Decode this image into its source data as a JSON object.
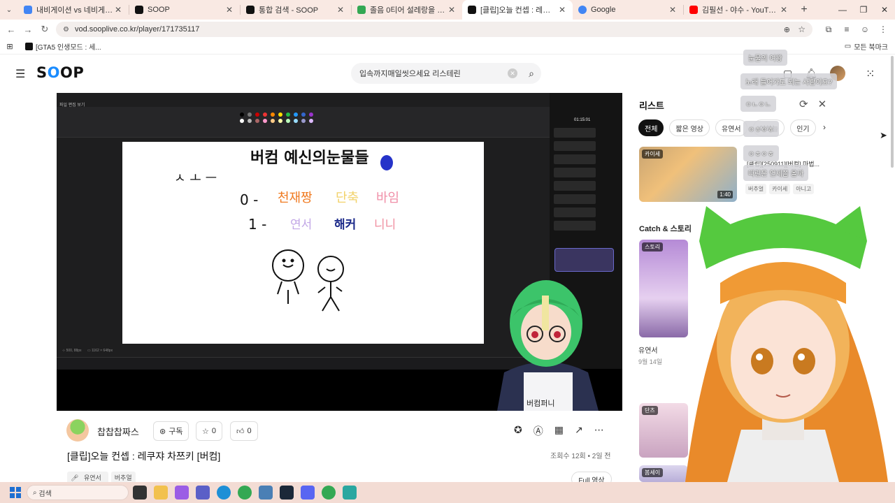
{
  "browser": {
    "tabs": [
      {
        "title": "내비게이션 vs 네비게이션 - Go",
        "color": "#4285f4",
        "active": false
      },
      {
        "title": "SOOP",
        "color": "#111111",
        "active": false
      },
      {
        "title": "통합 검색 - SOOP",
        "color": "#111111",
        "active": false
      },
      {
        "title": "졸음 0티어 설레랑을 상상하는",
        "color": "#34a853",
        "active": false
      },
      {
        "title": "[클립]오늘 컨셉 : 레쿠쟈 차",
        "color": "#111111",
        "active": true
      },
      {
        "title": "Google",
        "color": "#4285f4",
        "active": false
      },
      {
        "title": "김필선 - 야수 - YouTube",
        "color": "#ff0000",
        "active": false
      }
    ],
    "url": "vod.sooplive.co.kr/player/171735117",
    "bookmark": "[GTA5 인생모드 : 세...",
    "all_bookmarks": "모든 북마크"
  },
  "header": {
    "logo": "SOOP",
    "search_value": "입속까지매일씻으세요 리스테린"
  },
  "video": {
    "channel_name": "찹찹찹짜스",
    "subscribe_label": "구독",
    "fav_count": "0",
    "like_count": "0",
    "title": "[클립]오늘 컨셉 : 레쿠쟈 차쯔키 [버컴]",
    "views": "조회수 12회",
    "ago": "2일 전",
    "tags": [
      "유연서",
      "버추얼"
    ],
    "full_button": "Full 영상"
  },
  "paint": {
    "canvas_text": {
      "title": "버컴 예신의눈물들",
      "faces": "ㅅ ㅗ ㅡ",
      "row0_label": "0 -",
      "row0_items": [
        "천재짱",
        "단축",
        "바임"
      ],
      "row1_label": "1 -",
      "row1_items": [
        "연서",
        "해커",
        "니니"
      ]
    },
    "chat_time": "01:15:01",
    "stream_shirt": "버컴퍼니"
  },
  "list": {
    "title": "리스트",
    "filters": [
      "전체",
      "짧은 영상",
      "유연서",
      "이하늘",
      "인기"
    ],
    "item1": {
      "badge": "카이세",
      "title": "[클립][250911][버컴] 마법...",
      "duration": "1:40",
      "tags": [
        "버추얼",
        "카이세",
        "아니고"
      ]
    },
    "section2_title": "Catch & 스토리",
    "item2": {
      "badge": "스토리",
      "name": "유연서",
      "date": "9월 14일"
    },
    "item3_badge": "단츠",
    "item4_badge": "봄세이"
  },
  "overlay_chat": [
    "눈물의 여왕",
    "노래 틀어가도 되는 사람이요?",
    "ㅇㄴㅇㄴ",
    "ㅇㅎㅇㅎ",
    "ㅇㅎㅇㅎ",
    "따린은 언제쯤 올까"
  ],
  "taskbar": {
    "search_placeholder": "검색"
  }
}
